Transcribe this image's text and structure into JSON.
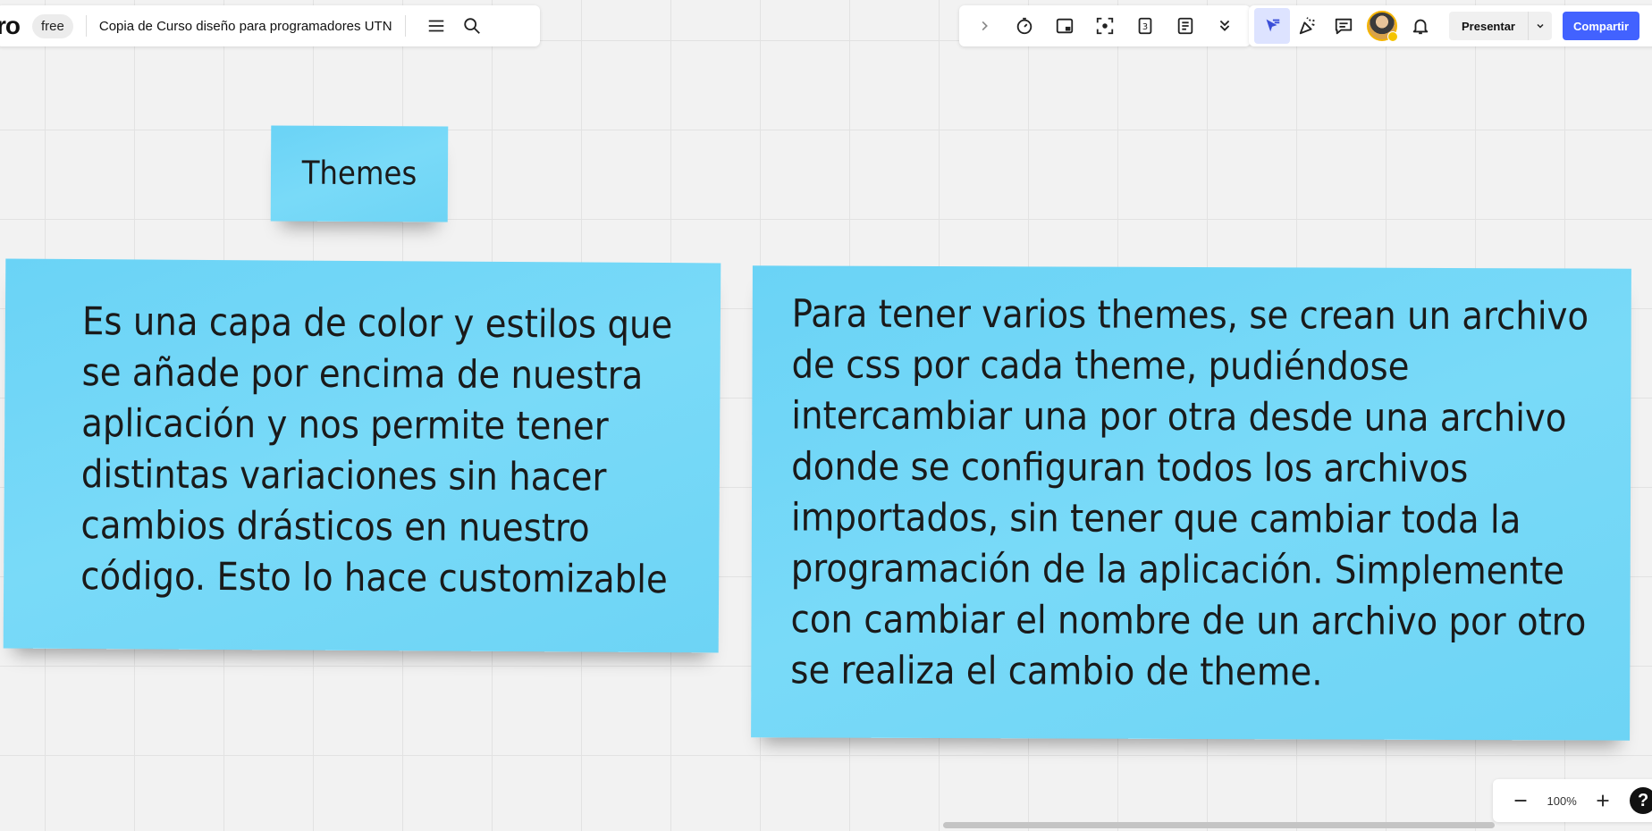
{
  "app": {
    "logo": "ro",
    "plan": "free"
  },
  "board": {
    "title": "Copia de Curso diseño para programadores UTN"
  },
  "toolbar_left": {
    "icons": [
      "menu-icon",
      "search-icon"
    ]
  },
  "toolbar_tools": {
    "icons": [
      "chevron-right-icon",
      "timer-icon",
      "card-icon",
      "focus-icon",
      "counter-icon",
      "notes-icon",
      "more-icon"
    ],
    "counter_digit": "3"
  },
  "toolbar_collab": {
    "icons": [
      "cursor-icon",
      "reactions-icon",
      "comment-icon",
      "bell-icon"
    ],
    "present_label": "Presentar",
    "share_label": "Compartir"
  },
  "stickies": [
    {
      "text": "Themes"
    },
    {
      "text": "Es una capa de color y estilos que se añade por encima de nuestra aplicación y nos permite tener distintas variaciones sin hacer cambios drásticos en nuestro código. Esto lo hace customizable"
    },
    {
      "text": "Para tener varios themes, se crean un archivo de css por cada theme, pudiéndose intercambiar una por otra desde una archivo donde se configuran todos los archivos importados, sin tener que cambiar toda la programación de la aplicación. Simplemente con cambiar el nombre de un archivo por otro se realiza el cambio de theme."
    }
  ],
  "zoom": {
    "value": "100%",
    "help": "?"
  },
  "colors": {
    "sticky": "#6ad3f6",
    "accent": "#4262ff",
    "canvas": "#f2f2f2"
  }
}
